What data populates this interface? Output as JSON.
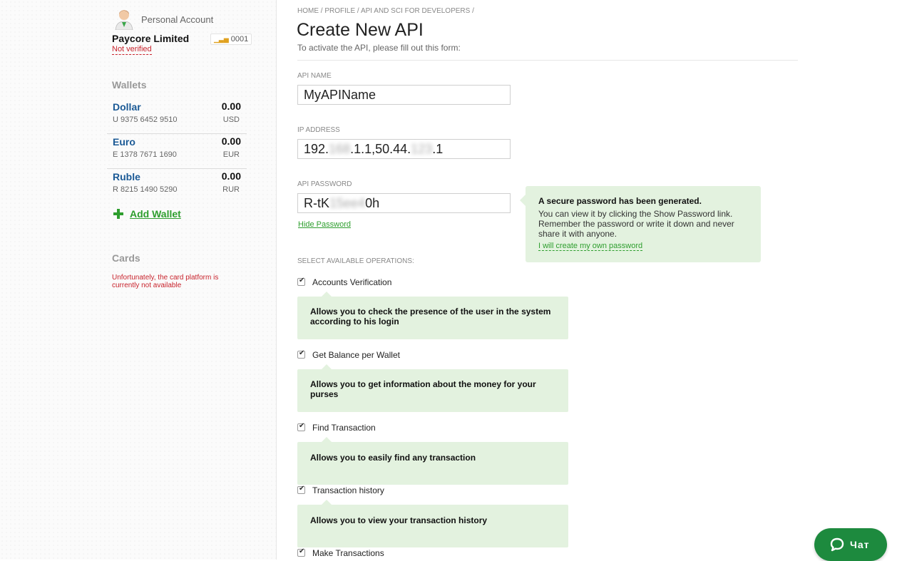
{
  "account": {
    "type_label": "Personal Account",
    "company": "Paycore Limited",
    "verification": "Not verified",
    "rank": "0001",
    "colors": {
      "link": "#1b5a96",
      "green": "#2e9e2e",
      "error": "#c8232c"
    }
  },
  "wallets": {
    "title": "Wallets",
    "items": [
      {
        "name": "Dollar",
        "number": "U 9375 6452 9510",
        "amount": "0.00",
        "currency": "USD"
      },
      {
        "name": "Euro",
        "number": "E 1378 7671 1690",
        "amount": "0.00",
        "currency": "EUR"
      },
      {
        "name": "Ruble",
        "number": "R 8215 1490 5290",
        "amount": "0.00",
        "currency": "RUR"
      }
    ],
    "add_label": "Add Wallet"
  },
  "cards": {
    "title": "Cards",
    "message": "Unfortunately, the card platform is currently not available"
  },
  "breadcrumb": [
    "HOME",
    "PROFILE",
    "API AND SCI FOR DEVELOPERS"
  ],
  "page": {
    "title": "Create New API",
    "subtitle": "To activate the API, please fill out this form:"
  },
  "form": {
    "api_name_label": "API NAME",
    "api_name_value": "MyAPIName",
    "ip_label": "IP ADDRESS",
    "ip_parts": [
      "192.",
      "168",
      ".1.1,50.44.",
      "123",
      ".1"
    ],
    "password_label": "API PASSWORD",
    "password_parts": [
      "R-tK",
      "15ee4",
      "0h"
    ],
    "hide_password": "Hide Password",
    "ops_label": "SELECT AVAILABLE OPERATIONS:"
  },
  "password_tip": {
    "title": "A secure password has been generated.",
    "body": "You can view it by clicking the Show Password link. Remember the password or write it down and never share it with anyone.",
    "link": "I will create my own password"
  },
  "operations": [
    {
      "label": "Accounts Verification",
      "description": "Allows you to check the presence of the user in the system according to his login",
      "checked": true
    },
    {
      "label": "Get Balance per Wallet",
      "description": "Allows you to get information about the money for your purses",
      "checked": true
    },
    {
      "label": "Find Transaction",
      "description": "Allows you to easily find any transaction",
      "checked": true
    },
    {
      "label": "Transaction history",
      "description": "Allows you to view your transaction history",
      "checked": true
    },
    {
      "label": "Make Transactions",
      "checked": true
    }
  ],
  "chat": {
    "label": "Чат",
    "icon": "chat-bubble-icon",
    "color": "#1d8a3e"
  }
}
